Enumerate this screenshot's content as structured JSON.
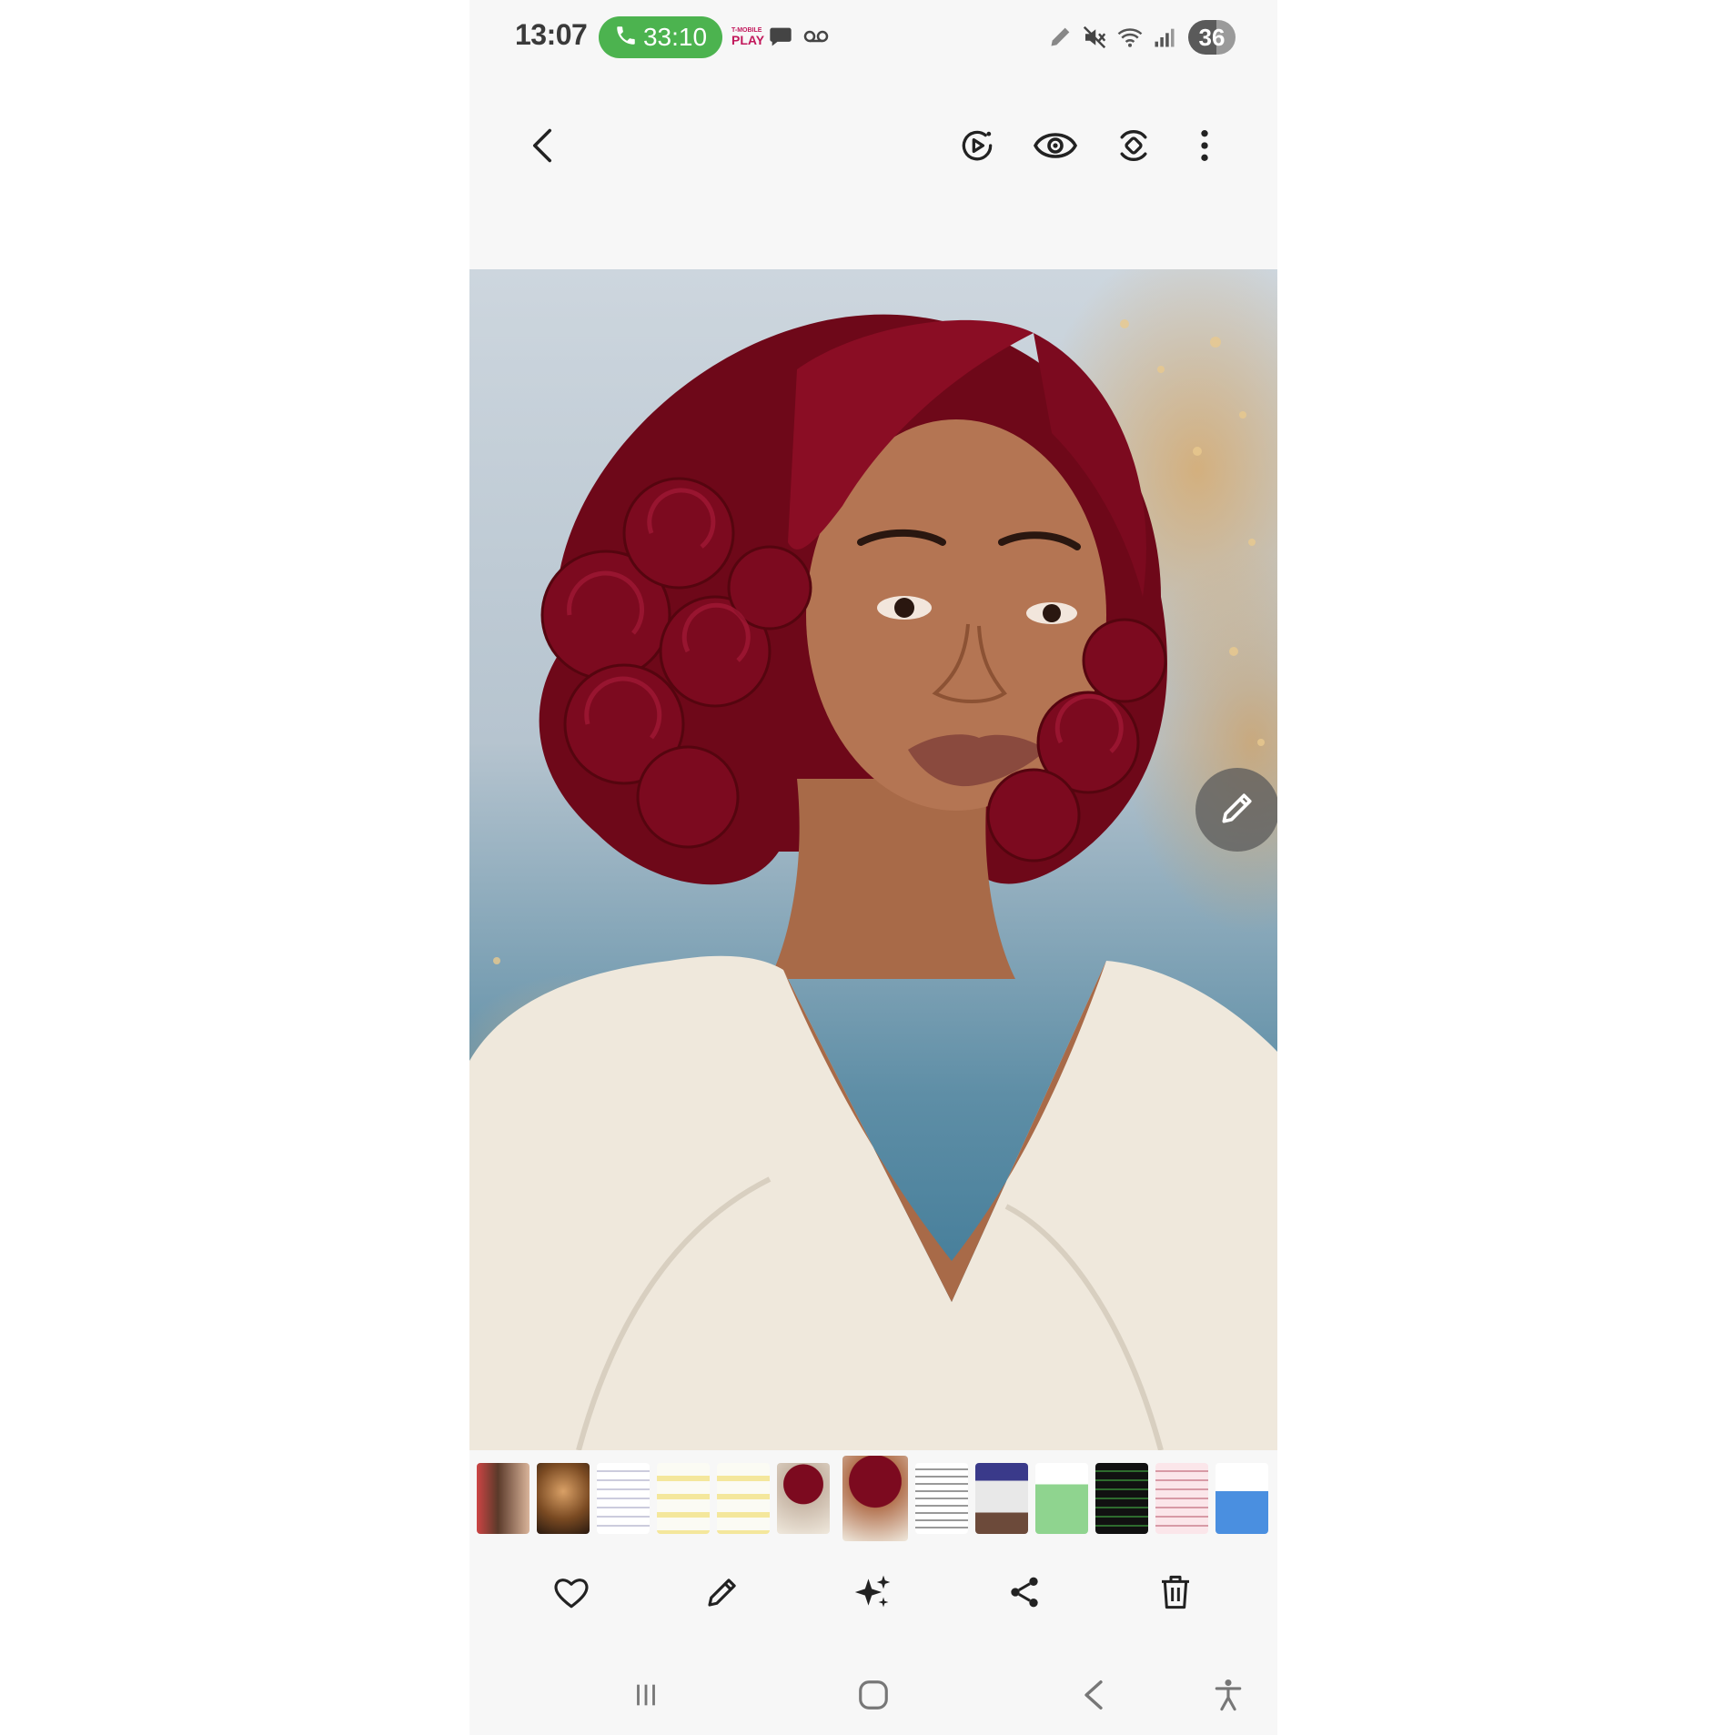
{
  "status_bar": {
    "time": "13:07",
    "call_timer": "33:10",
    "carrier_top": "T-MOBILE",
    "carrier_bottom": "PLAY",
    "battery": "36",
    "icons": [
      "phone-icon",
      "chat-bubble-icon",
      "voicemail-icon",
      "pencil-icon",
      "mute-icon",
      "wifi-icon",
      "signal-icon"
    ]
  },
  "toolbar": {
    "icons": [
      "back-icon",
      "motion-photo-icon",
      "eye-icon",
      "rotate-icon",
      "more-options-icon"
    ]
  },
  "viewer": {
    "image": "portrait-photo",
    "fab_icon": "pencil-icon"
  },
  "filmstrip": {
    "selected_index": 6,
    "thumbnails": [
      "photo",
      "photo",
      "document",
      "chat",
      "chat",
      "photo",
      "photo",
      "document",
      "newspaper",
      "document",
      "dark-document",
      "pink-document",
      "blue-document"
    ]
  },
  "actions": {
    "icons": [
      "heart-icon",
      "edit-icon",
      "sparkle-icon",
      "share-icon",
      "trash-icon"
    ]
  },
  "navbar": {
    "icons": [
      "recents-icon",
      "home-icon",
      "back-nav-icon",
      "accessibility-icon"
    ]
  },
  "colors": {
    "call_green": "#4cb34f",
    "carrier_magenta": "#c2185b",
    "hair_burgundy": "#7c0a1f",
    "blouse_ivory": "#efe8dc"
  }
}
